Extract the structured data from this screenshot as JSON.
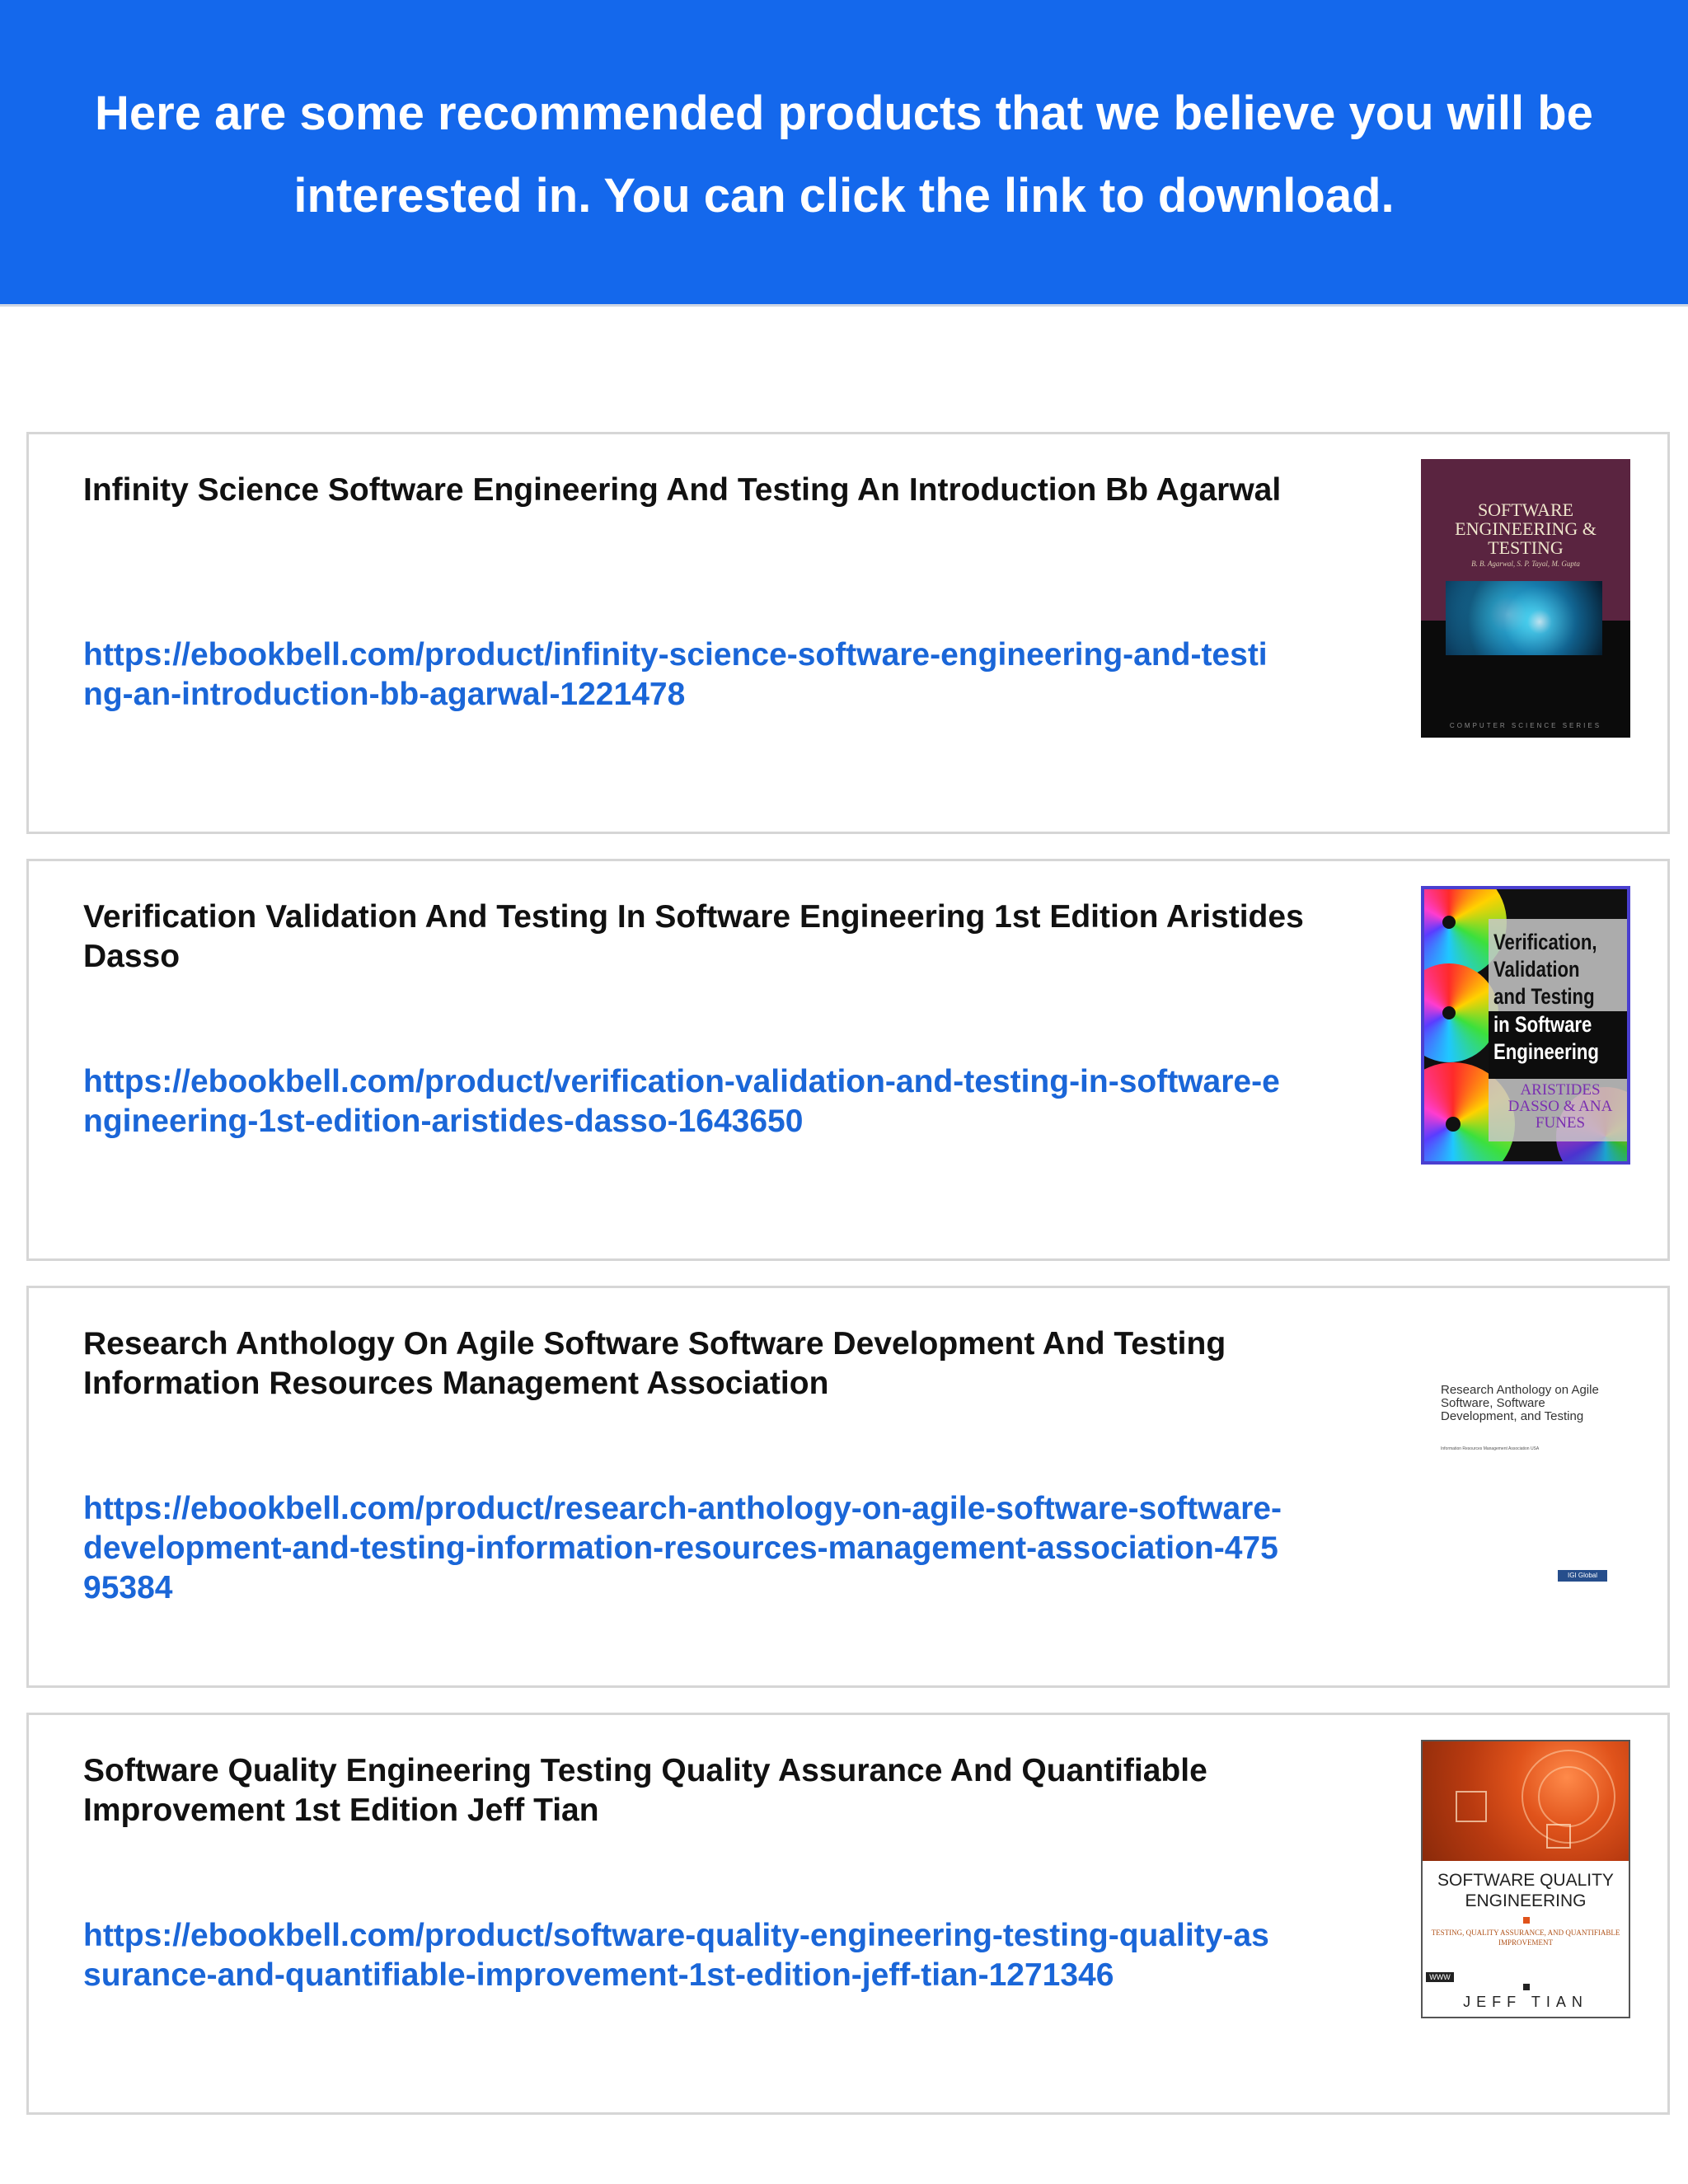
{
  "header": {
    "text": "Here are some recommended products that we believe you will be interested in. You can click the link to download.",
    "background_color": "#1468ec"
  },
  "products": [
    {
      "title": "Infinity Science Software Engineering And Testing An Introduction Bb Agarwal",
      "link": "https://ebookbell.com/product/infinity-science-software-engineering-and-testing-an-introduction-bb-agarwal-1221478",
      "cover": {
        "title": "SOFTWARE ENGINEERING & TESTING",
        "authors": "B. B. Agarwal, S. P. Tayal, M. Gupta",
        "series": "COMPUTER SCIENCE SERIES"
      }
    },
    {
      "title": "Verification Validation And Testing In Software Engineering 1st Edition Aristides Dasso",
      "link": "https://ebookbell.com/product/verification-validation-and-testing-in-software-engineering-1st-edition-aristides-dasso-1643650",
      "cover": {
        "title_top": "Verification, Validation and Testing",
        "title_bottom": "in Software Engineering",
        "authors": "ARISTIDES DASSO & ANA FUNES"
      }
    },
    {
      "title": "Research Anthology On Agile Software Software Development And Testing Information Resources Management Association",
      "link": "https://ebookbell.com/product/research-anthology-on-agile-software-software-development-and-testing-information-resources-management-association-47595384",
      "cover": {
        "title": "Research Anthology on Agile Software, Software Development, and Testing",
        "small": "Information Resources Management Association USA",
        "logo": "IGI Global"
      }
    },
    {
      "title": "Software Quality Engineering Testing Quality Assurance And Quantifiable Improvement 1st Edition Jeff Tian",
      "link": "https://ebookbell.com/product/software-quality-engineering-testing-quality-assurance-and-quantifiable-improvement-1st-edition-jeff-tian-1271346",
      "cover": {
        "title": "SOFTWARE QUALITY ENGINEERING",
        "subtitle": "TESTING, QUALITY ASSURANCE, AND QUANTIFIABLE IMPROVEMENT",
        "badge": "WWW",
        "author": "JEFF TIAN"
      }
    }
  ]
}
